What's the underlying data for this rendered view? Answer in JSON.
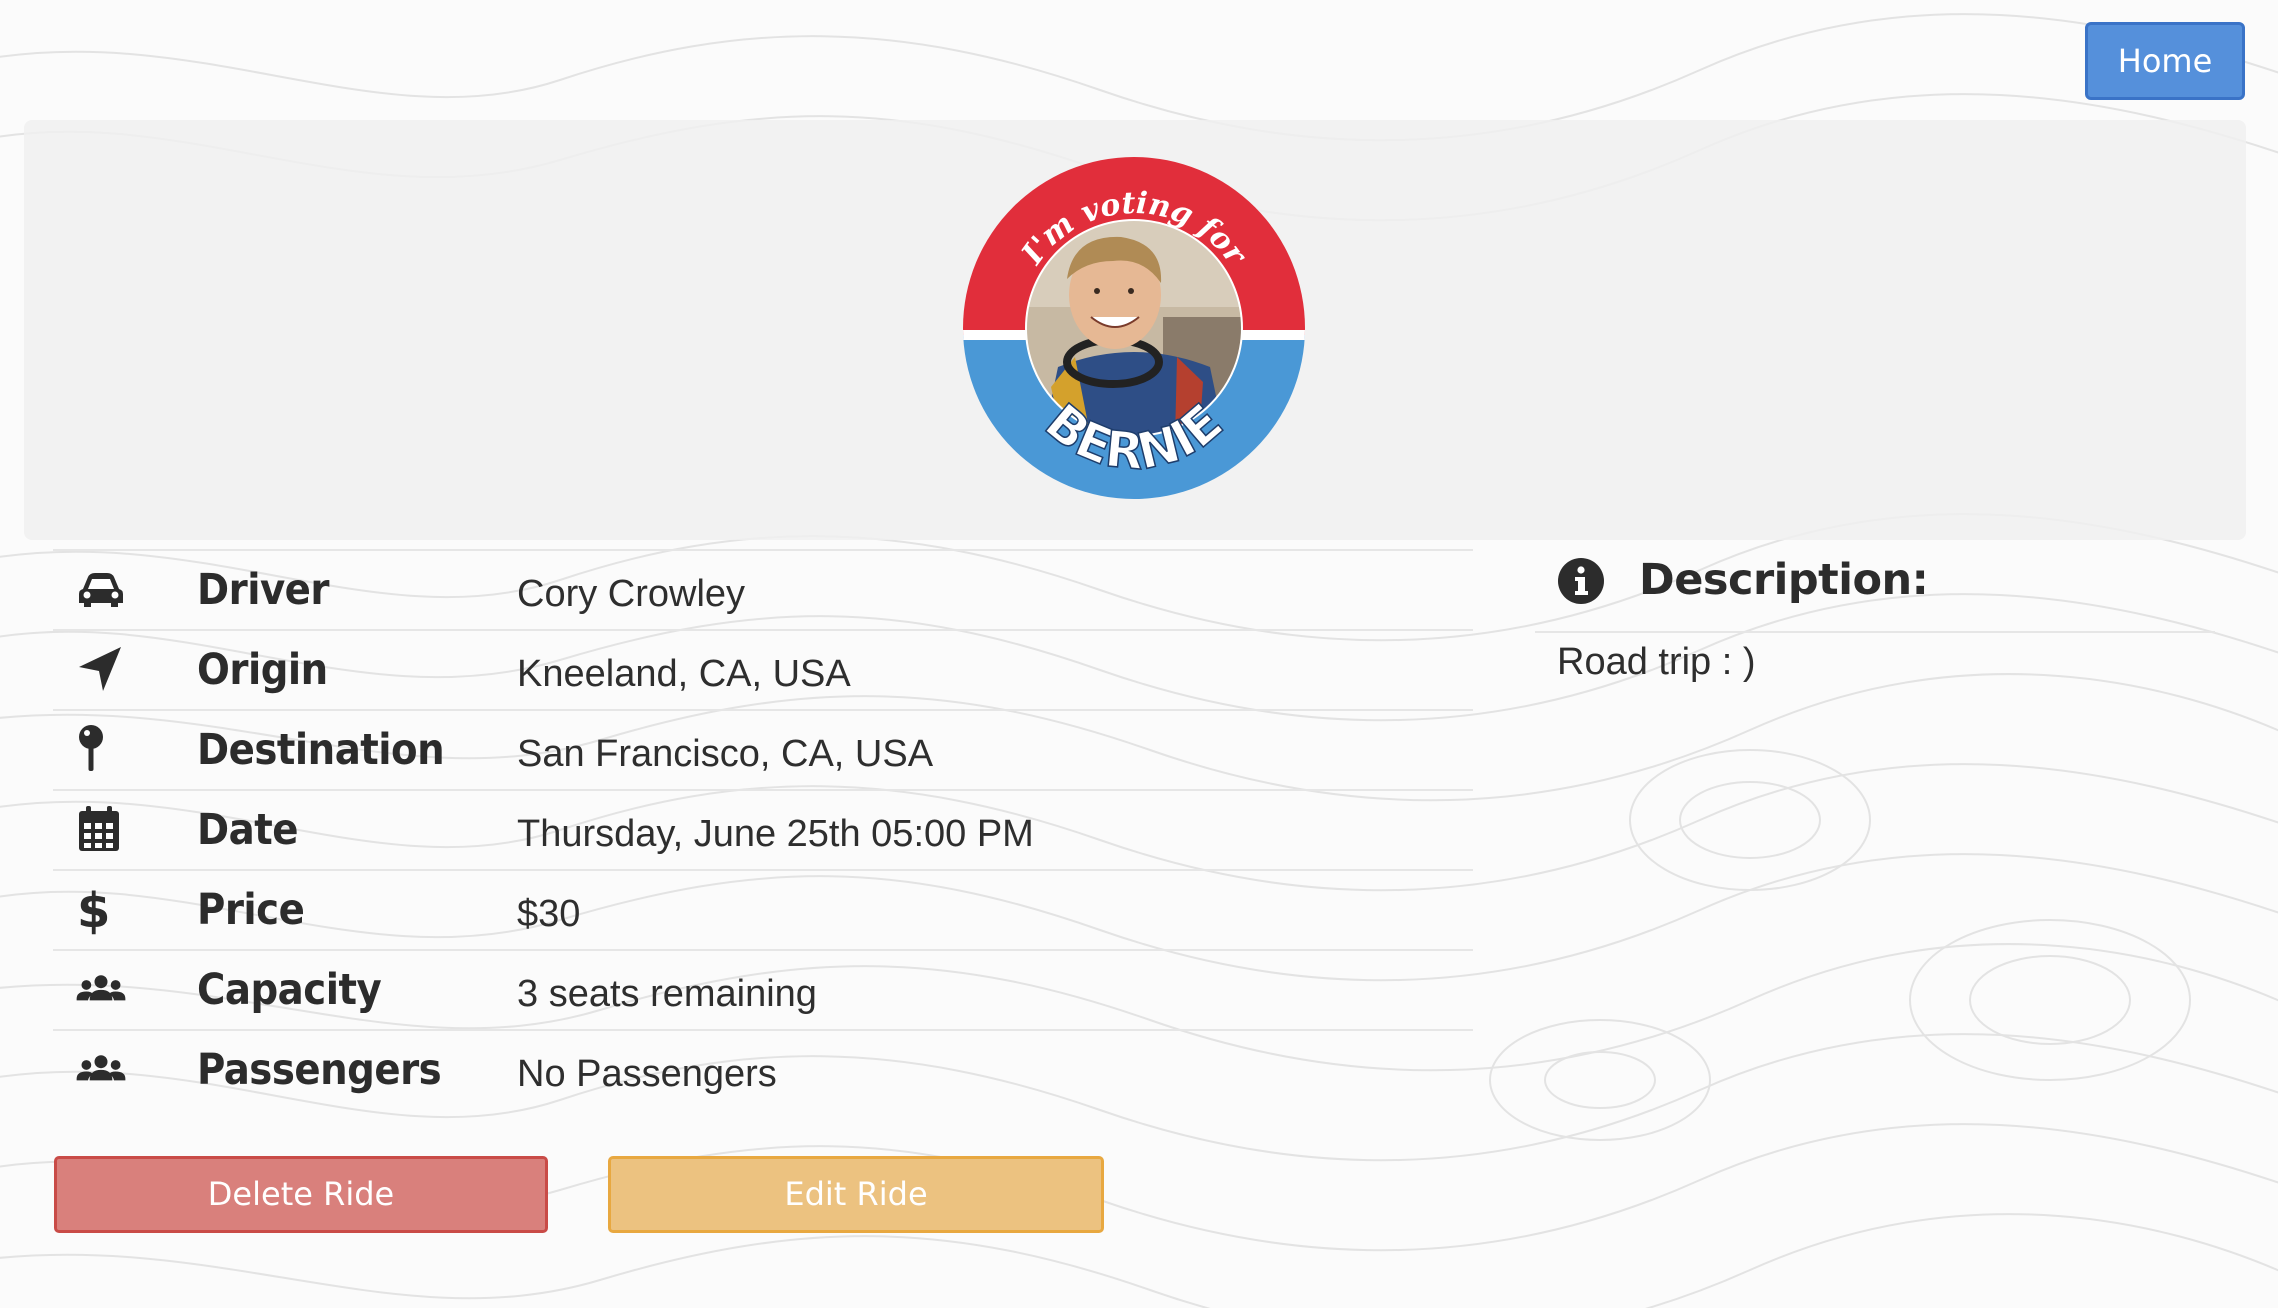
{
  "header": {
    "home_label": "Home"
  },
  "avatar": {
    "badge_top_text": "I'm voting for",
    "badge_bottom_text": "BERNIE",
    "colors": {
      "red": "#e12e3b",
      "blue": "#4a98d6"
    }
  },
  "ride": {
    "rows": [
      {
        "icon": "car-icon",
        "label": "Driver",
        "value": "Cory Crowley"
      },
      {
        "icon": "location-arrow-icon",
        "label": "Origin",
        "value": "Kneeland, CA, USA"
      },
      {
        "icon": "map-pin-icon",
        "label": "Destination",
        "value": "San Francisco, CA, USA"
      },
      {
        "icon": "calendar-icon",
        "label": "Date",
        "value": "Thursday, June 25th 05:00 PM"
      },
      {
        "icon": "dollar-icon",
        "label": "Price",
        "value": "$30"
      },
      {
        "icon": "users-icon",
        "label": "Capacity",
        "value": "3 seats remaining"
      },
      {
        "icon": "users-icon",
        "label": "Passengers",
        "value": "No Passengers"
      }
    ]
  },
  "description": {
    "icon": "info-circle-icon",
    "title": "Description:",
    "text": "Road trip : )"
  },
  "actions": {
    "delete_label": "Delete Ride",
    "edit_label": "Edit Ride",
    "delete_color": "#d9807c",
    "edit_color": "#ecc280"
  }
}
